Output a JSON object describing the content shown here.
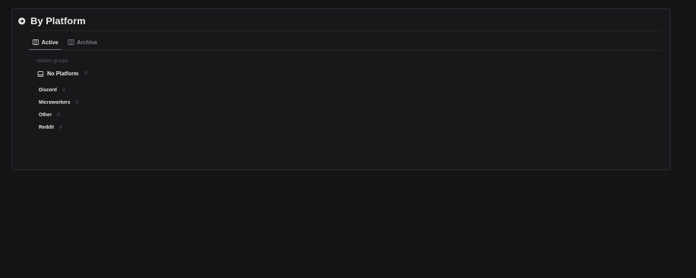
{
  "header": {
    "title": "By Platform",
    "icon": "arrow-circle-right-icon"
  },
  "tabs": [
    {
      "label": "Active",
      "icon": "board-icon",
      "active": true
    },
    {
      "label": "Archive",
      "icon": "board-icon",
      "active": false
    }
  ],
  "hidden_groups_label": "Hidden groups",
  "group": {
    "name": "No Platform",
    "count": "0",
    "icon": "inbox-icon"
  },
  "items": [
    {
      "name": "Discord",
      "count": "0"
    },
    {
      "name": "Microworkers",
      "count": "0"
    },
    {
      "name": "Other",
      "count": "0"
    },
    {
      "name": "Reddit",
      "count": "0"
    }
  ],
  "colors": {
    "background": "#141517",
    "panel": "#17181a",
    "text": "#e8e8e8",
    "muted": "#55575b"
  }
}
